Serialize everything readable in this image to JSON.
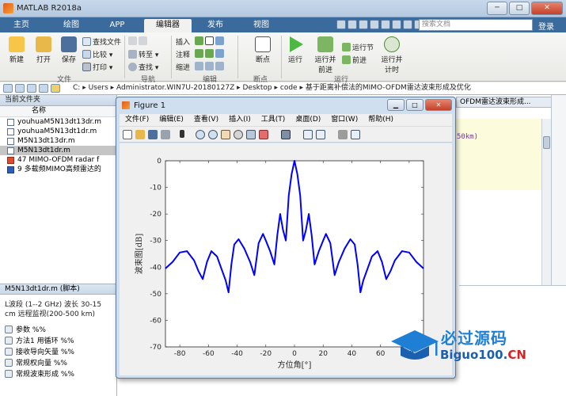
{
  "window": {
    "title": "MATLAB R2018a",
    "min": "─",
    "max": "□",
    "close": "✕"
  },
  "tabs": [
    "主页",
    "绘图",
    "APP",
    "编辑器",
    "发布",
    "视图"
  ],
  "search": {
    "placeholder": "搜索文档"
  },
  "login": "登录",
  "ribbon": {
    "new": "新建",
    "open": "打开",
    "save": "保存",
    "find_files": "查找文件",
    "compare": "比较",
    "print": "打印",
    "goto": "转至",
    "find": "查找",
    "insert": "插入",
    "comment": "注释",
    "indent": "缩进",
    "breakpoints": "断点",
    "run": "运行",
    "run_advance": "运行并\n前进",
    "run_section": "运行节",
    "advance": "前进",
    "run_time": "运行并\n计时",
    "group_file": "文件",
    "group_nav": "导航",
    "group_edit": "编辑",
    "group_bp": "断点",
    "group_run": "运行"
  },
  "path": [
    "C:",
    "Users",
    "Administrator.WIN7U-20180127Z",
    "Desktop",
    "code",
    "基于距离补偿法的MIMO-OFDM雷达波束形成及优化"
  ],
  "left_pane": {
    "title": "当前文件夹",
    "col_name": "名称",
    "files": [
      "youhuaM5N13dt13dr.m",
      "youhuaM5N13dt1dr.m",
      "M5N13dt13dr.m",
      "M5N13dt1dr.m",
      "47 MIMO-OFDM radar f",
      "9 多载频MIMO高频雷达的"
    ],
    "detail_title": "M5N13dt1dr.m (脚本)",
    "detail_text": "L波段 (1--2 GHz) 波长 30-15 cm 远程监视(200-500 km)",
    "detail_items": [
      "参数 %%",
      "方法1 用循环 %%",
      "接收导向矢量 %%",
      "常规权向量 %%",
      "常规波束形成 %%"
    ]
  },
  "editor": {
    "tab_label": "OFDM雷达波束形成...",
    "code_fragment": "50km)"
  },
  "figure": {
    "title": "Figure 1",
    "menu": [
      "文件(F)",
      "编辑(E)",
      "查看(V)",
      "插入(I)",
      "工具(T)",
      "桌面(D)",
      "窗口(W)",
      "帮助(H)"
    ],
    "btn_min": "▁",
    "btn_max": "□",
    "btn_close": "✕"
  },
  "chart_data": {
    "type": "line",
    "xlabel": "方位角[°]",
    "ylabel": "波束图[dB]",
    "xlim": [
      -90,
      90
    ],
    "ylim": [
      -70,
      0
    ],
    "xticks": [
      -80,
      -60,
      -40,
      -20,
      0,
      20,
      40,
      60,
      80
    ],
    "yticks": [
      0,
      -10,
      -20,
      -30,
      -40,
      -50,
      -60,
      -70
    ],
    "grid": false,
    "line_color": "#0000ff",
    "x": [
      -90,
      -85,
      -80,
      -75,
      -70,
      -67,
      -64,
      -61,
      -58,
      -54,
      -51,
      -48,
      -46,
      -44,
      -42,
      -39,
      -35,
      -31,
      -28,
      -25,
      -22,
      -20,
      -17,
      -14,
      -12,
      -10,
      -8,
      -6,
      -4,
      -2,
      0,
      2,
      4,
      6,
      8,
      10,
      12,
      14,
      17,
      20,
      22,
      25,
      28,
      31,
      35,
      39,
      42,
      44,
      46,
      48,
      51,
      54,
      58,
      61,
      64,
      67,
      70,
      75,
      80,
      85,
      90
    ],
    "y": [
      -40.5,
      -38,
      -34.5,
      -34,
      -37.5,
      -41.5,
      -44.5,
      -38,
      -34,
      -36,
      -40.5,
      -45,
      -49.5,
      -39,
      -31.5,
      -29.5,
      -33,
      -38,
      -43,
      -31,
      -27.5,
      -30,
      -34,
      -39,
      -28,
      -20,
      -26,
      -30,
      -13,
      -5,
      0,
      -5,
      -13,
      -30,
      -26,
      -20,
      -28,
      -39,
      -34,
      -30,
      -27.5,
      -31,
      -43,
      -38,
      -33,
      -29.5,
      -31.5,
      -39,
      -49.5,
      -45,
      -40.5,
      -36,
      -34,
      -38,
      -44.5,
      -41.5,
      -37.5,
      -34,
      -34.5,
      -38,
      -40.5
    ]
  },
  "watermark": {
    "brand_cn": "必过源码",
    "domain_prefix": "Biguo100.",
    "domain_suffix": "CN"
  }
}
